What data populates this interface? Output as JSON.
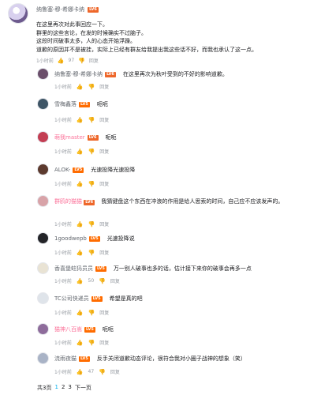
{
  "main": {
    "author": "纳鲁塞-穆-希娜卡纳",
    "level": "LV6",
    "text_lines": [
      "在这里再次对此事回应一下。",
      "群里的这些言论，在发的时候确实不过脑子。",
      "这段时间破事太多，人的心态开始浮躁。",
      "道歉的原因并不是被挂，实际上已经有群友给我提出我这些话不好，而我也承认了这一点。"
    ],
    "time": "1小时前",
    "likes": "97",
    "reply_label": "回复"
  },
  "replies": [
    {
      "name": "纳鲁塞-穆-希娜卡纳",
      "vip": false,
      "level": "LV6",
      "text": "在这里再次为秋叶受到的不好的影响道歉。",
      "time": "1小时前",
      "likes": "",
      "reply": "回复"
    },
    {
      "name": "雪梅鑫落",
      "vip": false,
      "level": "LV5",
      "text": "呃呃",
      "time": "1小时前",
      "likes": "",
      "reply": "回复"
    },
    {
      "name": "萌我master",
      "vip": true,
      "level": "LV6",
      "text": "呃呃",
      "time": "1小时前",
      "likes": "",
      "reply": "回复"
    },
    {
      "name": "ALOK-",
      "vip": false,
      "level": "LV5",
      "text": "光速投降光速投降",
      "time": "1小时前",
      "likes": "",
      "reply": "回复"
    },
    {
      "name": "群鸥的猫猫",
      "vip": true,
      "level": "LV6",
      "text": "我猜键盘这个东西在冲浪的作用是给人思索的时间，自己应不应该发声的。",
      "time": "1小时前",
      "likes": "",
      "reply": "回复"
    },
    {
      "name": "1goodwepb",
      "vip": false,
      "level": "LV5",
      "text": "光速投降说",
      "time": "1小时前",
      "likes": "",
      "reply": "回复"
    },
    {
      "name": "香喜堡蛀犸员员",
      "vip": false,
      "level": "LV5",
      "text": "万一别人破事也多的话，估计接下来你的破事会再多一点",
      "time": "1小时前",
      "likes": "50",
      "reply": "回复"
    },
    {
      "name": "TC公司快递员",
      "vip": false,
      "level": "LV5",
      "text": "希望是真的吧",
      "time": "1小时前",
      "likes": "",
      "reply": "回复"
    },
    {
      "name": "猫神八百嵩",
      "vip": true,
      "level": "LV5",
      "text": "呃呃",
      "time": "1小时前",
      "likes": "",
      "reply": "回复"
    },
    {
      "name": "流雨夜猫",
      "vip": false,
      "level": "LV5",
      "text": "反手关闭道歉动态评论，很符合我对小圈子战神的想象（笑）",
      "time": "1小时前",
      "likes": "47",
      "reply": "回复"
    }
  ],
  "pager": {
    "total": "共3页",
    "pages": [
      "1",
      "2",
      "3"
    ],
    "next": "下一页"
  },
  "colors": {
    "accent": "#00aeec",
    "vip": "#fb7299",
    "level": "#ff6c00"
  }
}
